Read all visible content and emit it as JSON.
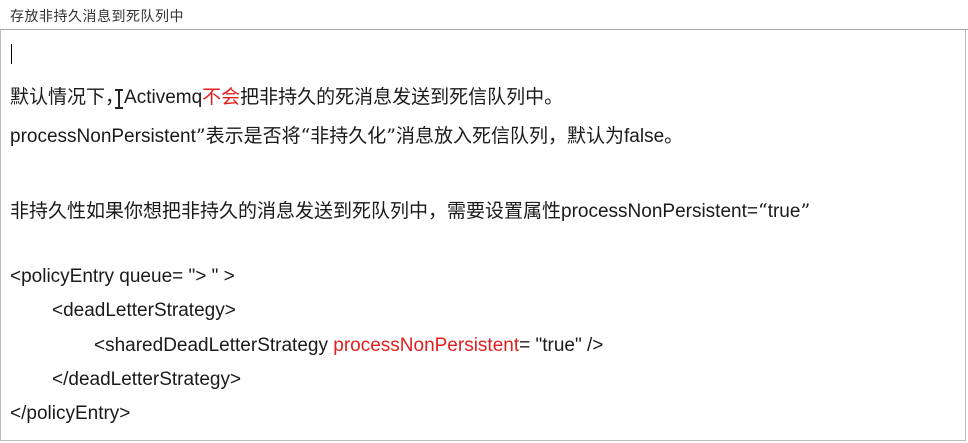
{
  "document": {
    "title": "存放非持久消息到死队列中",
    "paragraph1": {
      "part1": "默认情况下，",
      "part2": "Activemq",
      "part3_red": "不会",
      "part4": "把非持久的死消息发送到死信队列中。"
    },
    "paragraph2": {
      "part1": "processNonPersistent",
      "part2": "”表示是否将“非持久化”消息放入死信队列，默认为",
      "part3": "false",
      "part4": "。"
    },
    "paragraph3": {
      "part1": "非持久性如果你想把非持久的消息发送到死队列中，需要设置属性",
      "part2": "processNonPersistent=",
      "part3": "“",
      "part4": "true",
      "part5": "”"
    },
    "code": {
      "line1": "<policyEntry queue= \"> \" >",
      "line2": "<deadLetterStrategy>",
      "line3_prefix": "<sharedDeadLetterStrategy ",
      "line3_red": "processNonPersistent",
      "line3_suffix": "= \"true\" />",
      "line4": "</deadLetterStrategy>",
      "line5": "</policyEntry>"
    }
  }
}
